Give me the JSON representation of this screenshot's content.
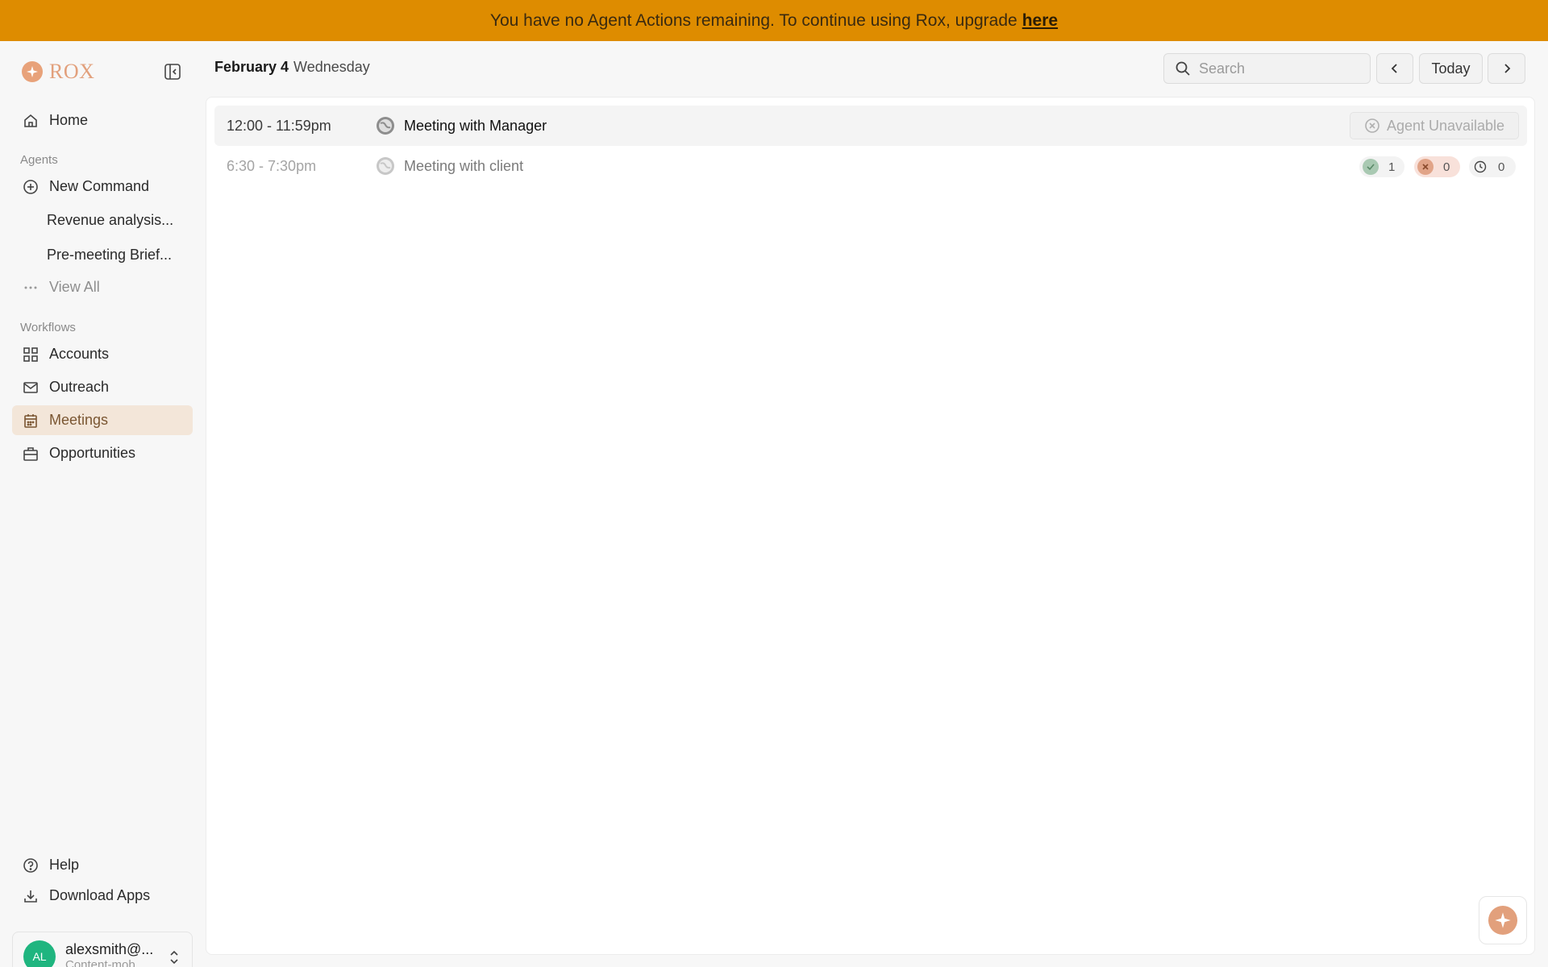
{
  "banner": {
    "message": "You have no Agent Actions remaining. To continue using Rox, upgrade",
    "link_label": "here",
    "color": "#de8c00"
  },
  "sidebar": {
    "brand": "ROX",
    "home_label": "Home",
    "agents_section": "Agents",
    "new_command_label": "New Command",
    "agent_items": [
      "Revenue analysis...",
      "Pre-meeting Brief..."
    ],
    "view_all_label": "View All",
    "workflows_section": "Workflows",
    "workflow_items": [
      "Accounts",
      "Outreach",
      "Meetings",
      "Opportunities"
    ],
    "active_item": "Meetings",
    "help_label": "Help",
    "download_label": "Download Apps",
    "user": {
      "initials": "AL",
      "name": "alexsmith@...",
      "org": "Content-mob..."
    }
  },
  "header": {
    "date": "February 4",
    "weekday": "Wednesday",
    "search_placeholder": "Search",
    "today_label": "Today"
  },
  "meetings": [
    {
      "time": "12:00 - 11:59pm",
      "title": "Meeting with Manager",
      "status_label": "Agent Unavailable"
    },
    {
      "time": "6:30 - 7:30pm",
      "title": "Meeting with client",
      "counts": {
        "done": "1",
        "failed": "0",
        "pending": "0"
      }
    }
  ],
  "colors": {
    "accent": "#e2a07c",
    "active_bg": "#f3e6d9",
    "avatar": "#1fb57f"
  }
}
